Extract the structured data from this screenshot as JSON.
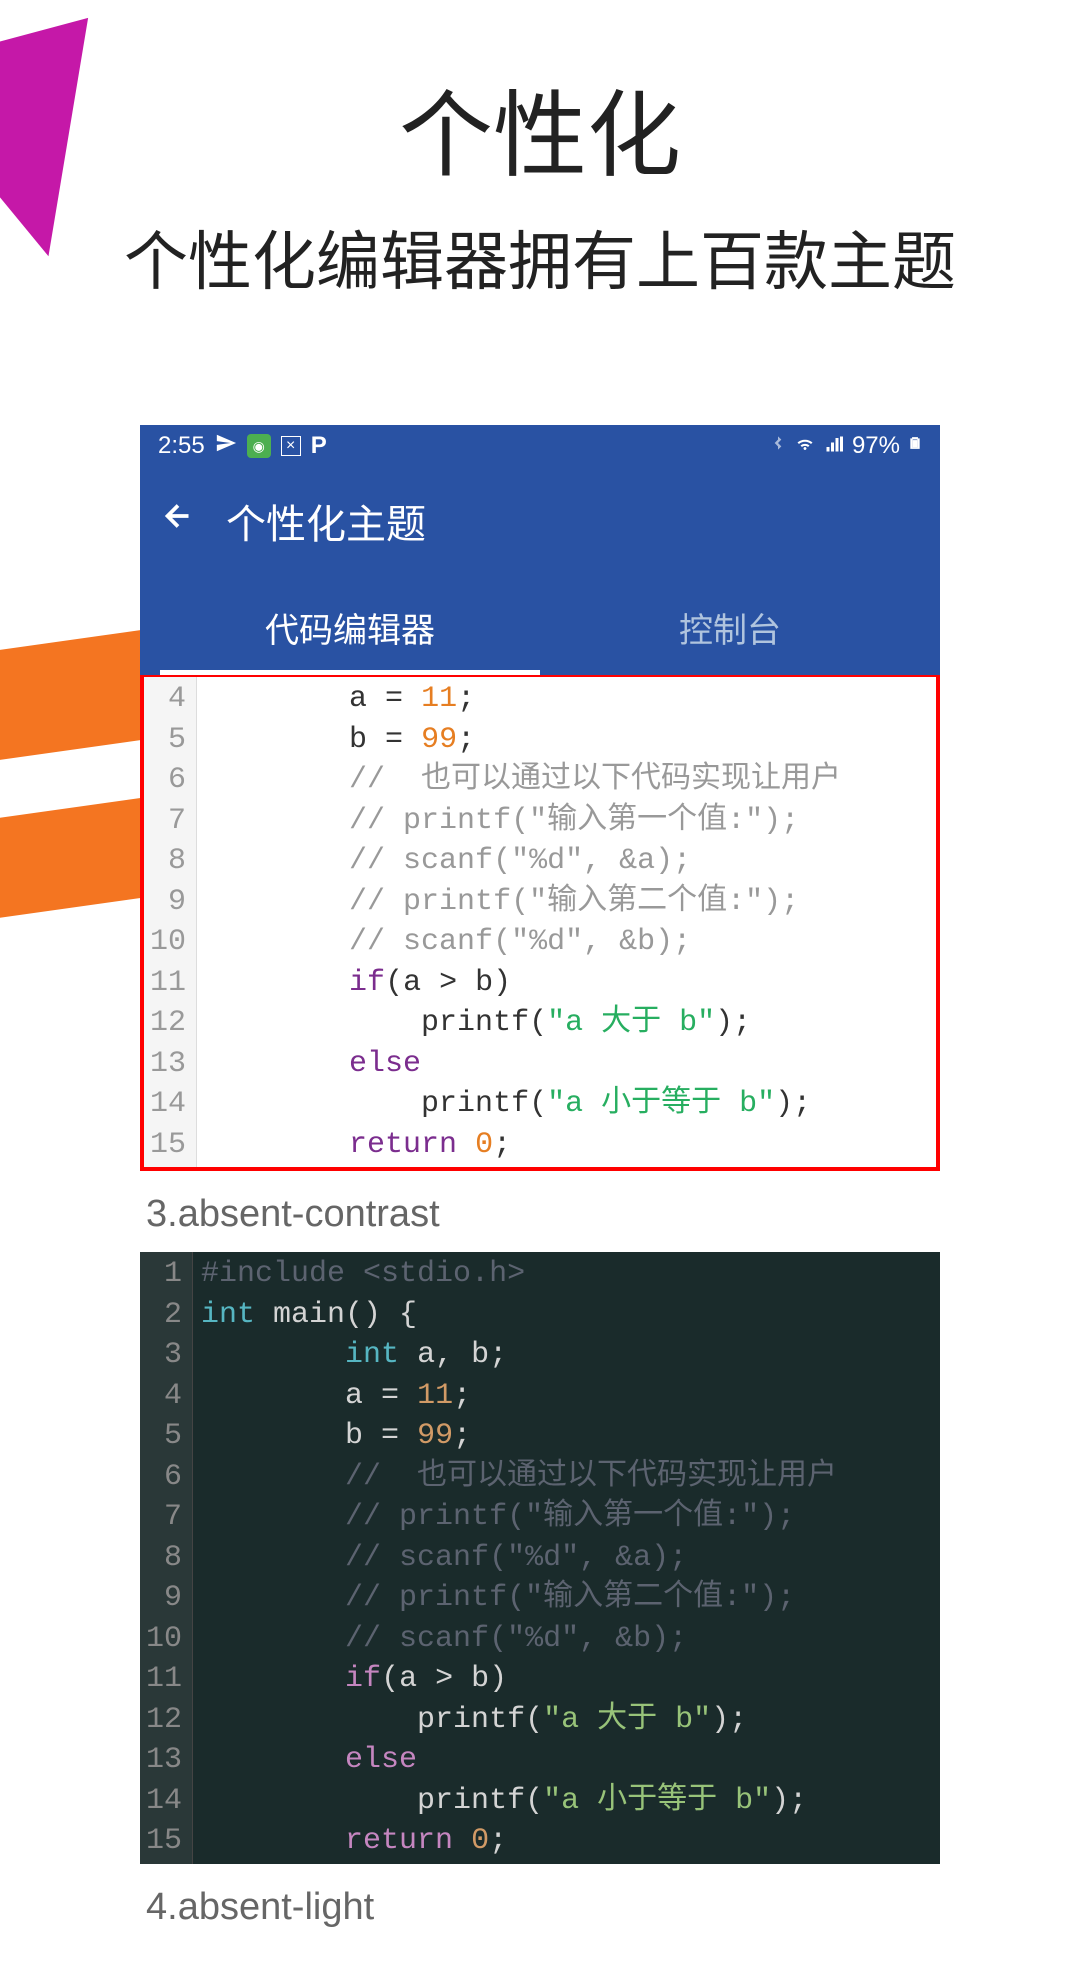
{
  "page": {
    "title": "个性化",
    "subtitle": "个性化编辑器拥有上百款主题"
  },
  "statusBar": {
    "time": "2:55",
    "battery": "97%"
  },
  "appHeader": {
    "title": "个性化主题",
    "tabs": [
      {
        "label": "代码编辑器",
        "active": true
      },
      {
        "label": "控制台",
        "active": false
      }
    ]
  },
  "themes": [
    {
      "index": "3",
      "name": "absent-contrast"
    },
    {
      "index": "4",
      "name": "absent-light"
    }
  ],
  "code": {
    "lightPartial": {
      "start": 4,
      "lines": [
        {
          "n": "4",
          "tokens": [
            {
              "t": "        a = ",
              "c": ""
            },
            {
              "t": "11",
              "c": "num"
            },
            {
              "t": ";",
              "c": ""
            }
          ]
        },
        {
          "n": "5",
          "tokens": [
            {
              "t": "        b = ",
              "c": ""
            },
            {
              "t": "99",
              "c": "num"
            },
            {
              "t": ";",
              "c": ""
            }
          ]
        },
        {
          "n": "6",
          "tokens": [
            {
              "t": "        //  也可以通过以下代码实现让用户",
              "c": "com"
            }
          ]
        },
        {
          "n": "7",
          "tokens": [
            {
              "t": "        // printf(\"输入第一个值:\");",
              "c": "com"
            }
          ]
        },
        {
          "n": "8",
          "tokens": [
            {
              "t": "        // scanf(\"%d\", &a);",
              "c": "com"
            }
          ]
        },
        {
          "n": "9",
          "tokens": [
            {
              "t": "        // printf(\"输入第二个值:\");",
              "c": "com"
            }
          ]
        },
        {
          "n": "10",
          "tokens": [
            {
              "t": "        // scanf(\"%d\", &b);",
              "c": "com"
            }
          ]
        },
        {
          "n": "11",
          "tokens": [
            {
              "t": "        ",
              "c": ""
            },
            {
              "t": "if",
              "c": "kw"
            },
            {
              "t": "(a > b)",
              "c": ""
            }
          ]
        },
        {
          "n": "12",
          "tokens": [
            {
              "t": "            printf(",
              "c": ""
            },
            {
              "t": "\"a 大于 b\"",
              "c": "str"
            },
            {
              "t": ");",
              "c": ""
            }
          ]
        },
        {
          "n": "13",
          "tokens": [
            {
              "t": "        ",
              "c": ""
            },
            {
              "t": "else",
              "c": "kw"
            }
          ]
        },
        {
          "n": "14",
          "tokens": [
            {
              "t": "            printf(",
              "c": ""
            },
            {
              "t": "\"a 小于等于 b\"",
              "c": "str"
            },
            {
              "t": ");",
              "c": ""
            }
          ]
        },
        {
          "n": "15",
          "tokens": [
            {
              "t": "        ",
              "c": ""
            },
            {
              "t": "return",
              "c": "kw"
            },
            {
              "t": " ",
              "c": ""
            },
            {
              "t": "0",
              "c": "num"
            },
            {
              "t": ";",
              "c": ""
            }
          ]
        }
      ]
    },
    "darkFull": {
      "lines": [
        {
          "n": "1",
          "tokens": [
            {
              "t": "#include <stdio.h>",
              "c": "com"
            }
          ]
        },
        {
          "n": "2",
          "tokens": [
            {
              "t": "int",
              "c": "type"
            },
            {
              "t": " main() {",
              "c": ""
            }
          ]
        },
        {
          "n": "3",
          "tokens": [
            {
              "t": "        ",
              "c": ""
            },
            {
              "t": "int",
              "c": "type"
            },
            {
              "t": " a, b;",
              "c": ""
            }
          ]
        },
        {
          "n": "4",
          "tokens": [
            {
              "t": "        a = ",
              "c": ""
            },
            {
              "t": "11",
              "c": "num"
            },
            {
              "t": ";",
              "c": ""
            }
          ]
        },
        {
          "n": "5",
          "tokens": [
            {
              "t": "        b = ",
              "c": ""
            },
            {
              "t": "99",
              "c": "num"
            },
            {
              "t": ";",
              "c": ""
            }
          ]
        },
        {
          "n": "6",
          "tokens": [
            {
              "t": "        //  也可以通过以下代码实现让用户",
              "c": "com"
            }
          ]
        },
        {
          "n": "7",
          "tokens": [
            {
              "t": "        // printf(\"输入第一个值:\");",
              "c": "com"
            }
          ]
        },
        {
          "n": "8",
          "tokens": [
            {
              "t": "        // scanf(\"%d\", &a);",
              "c": "com"
            }
          ]
        },
        {
          "n": "9",
          "tokens": [
            {
              "t": "        // printf(\"输入第二个值:\");",
              "c": "com"
            }
          ]
        },
        {
          "n": "10",
          "tokens": [
            {
              "t": "        // scanf(\"%d\", &b);",
              "c": "com"
            }
          ]
        },
        {
          "n": "11",
          "tokens": [
            {
              "t": "        ",
              "c": ""
            },
            {
              "t": "if",
              "c": "kw"
            },
            {
              "t": "(a > b)",
              "c": ""
            }
          ]
        },
        {
          "n": "12",
          "tokens": [
            {
              "t": "            printf(",
              "c": ""
            },
            {
              "t": "\"a 大于 b\"",
              "c": "str"
            },
            {
              "t": ");",
              "c": ""
            }
          ]
        },
        {
          "n": "13",
          "tokens": [
            {
              "t": "        ",
              "c": ""
            },
            {
              "t": "else",
              "c": "kw"
            }
          ]
        },
        {
          "n": "14",
          "tokens": [
            {
              "t": "            printf(",
              "c": ""
            },
            {
              "t": "\"a 小于等于 b\"",
              "c": "str"
            },
            {
              "t": ");",
              "c": ""
            }
          ]
        },
        {
          "n": "15",
          "tokens": [
            {
              "t": "        ",
              "c": ""
            },
            {
              "t": "return",
              "c": "kw"
            },
            {
              "t": " ",
              "c": ""
            },
            {
              "t": "0",
              "c": "num"
            },
            {
              "t": ";",
              "c": ""
            }
          ]
        }
      ]
    }
  }
}
